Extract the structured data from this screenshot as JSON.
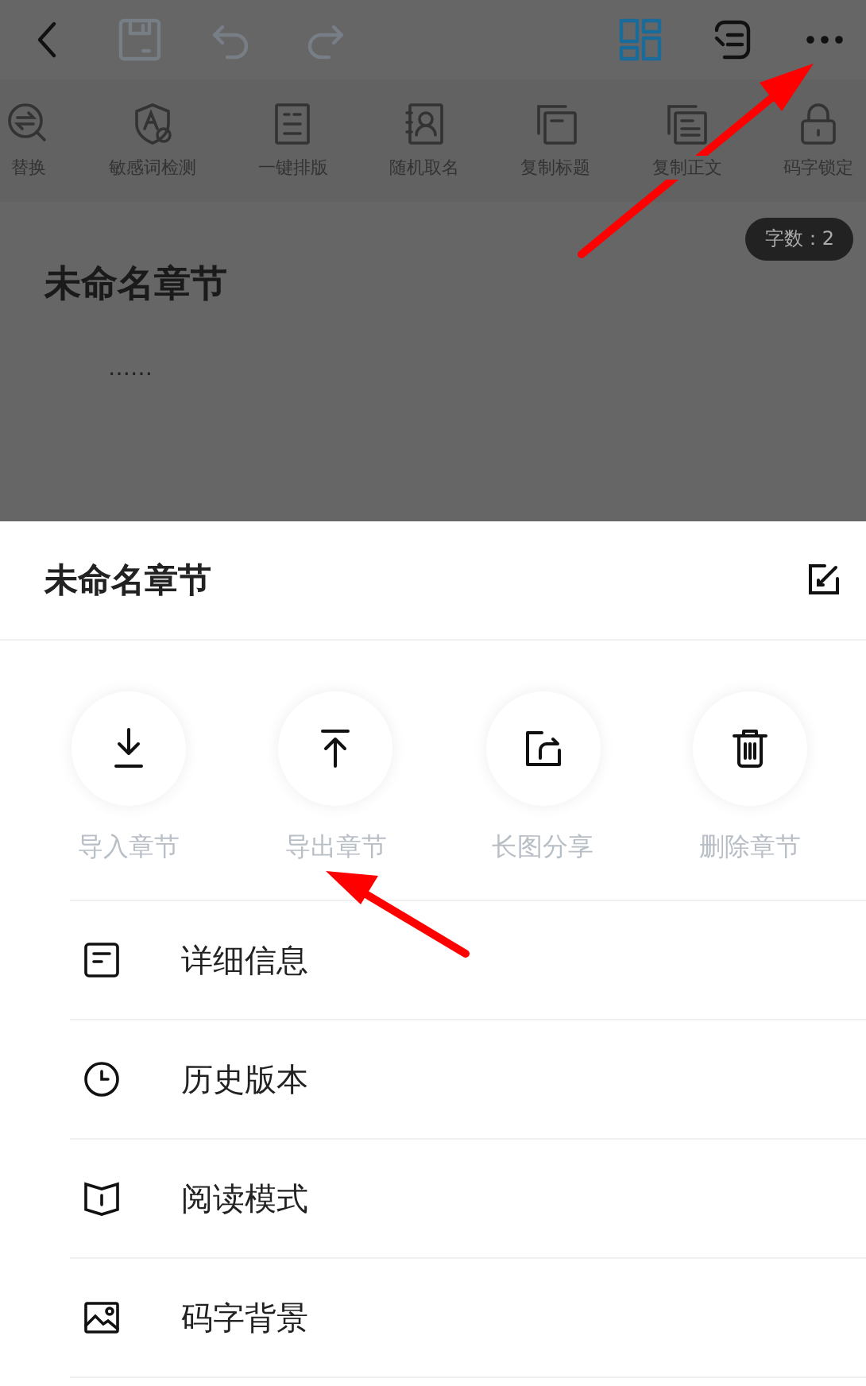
{
  "top_bar": {
    "buttons": [
      {
        "kind": "back",
        "disabled": false
      },
      {
        "kind": "save",
        "disabled": true
      },
      {
        "kind": "undo",
        "disabled": true
      },
      {
        "kind": "redo",
        "disabled": true
      },
      {
        "kind": "grid",
        "disabled": false
      },
      {
        "kind": "switch",
        "disabled": false
      },
      {
        "kind": "more",
        "disabled": false
      }
    ]
  },
  "toolbar": {
    "items": [
      {
        "label": "替换",
        "kind": "replace"
      },
      {
        "label": "敏感词检测",
        "kind": "check"
      },
      {
        "label": "一键排版",
        "kind": "format"
      },
      {
        "label": "随机取名",
        "kind": "name"
      },
      {
        "label": "复制标题",
        "kind": "copy"
      },
      {
        "label": "复制正文",
        "kind": "copytext"
      },
      {
        "label": "码字锁定",
        "kind": "lock"
      }
    ]
  },
  "word_count": "字数：2",
  "editor": {
    "title": "未命名章节",
    "body": "……"
  },
  "sheet": {
    "title": "未命名章节",
    "actions": [
      {
        "label": "导入章节",
        "kind": "import"
      },
      {
        "label": "导出章节",
        "kind": "export"
      },
      {
        "label": "长图分享",
        "kind": "share"
      },
      {
        "label": "删除章节",
        "kind": "delete"
      }
    ],
    "menu": [
      {
        "label": "详细信息",
        "kind": "info"
      },
      {
        "label": "历史版本",
        "kind": "history"
      },
      {
        "label": "阅读模式",
        "kind": "read"
      },
      {
        "label": "码字背景",
        "kind": "background"
      }
    ]
  }
}
